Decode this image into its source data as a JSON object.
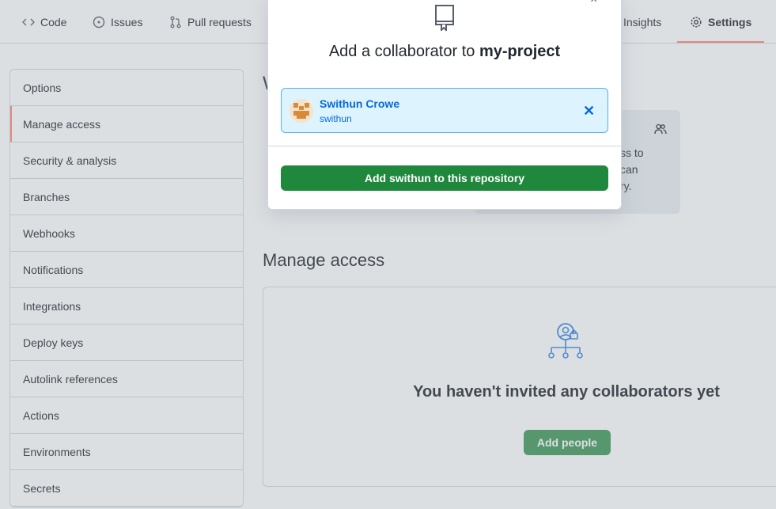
{
  "nav": {
    "tabs": [
      {
        "label": "Code",
        "icon": "code-icon"
      },
      {
        "label": "Issues",
        "icon": "issue-icon"
      },
      {
        "label": "Pull requests",
        "icon": "pull-request-icon"
      },
      {
        "label": "Insights",
        "icon": "graph-icon"
      },
      {
        "label": "Settings",
        "icon": "gear-icon",
        "selected": true
      }
    ]
  },
  "sidebar": {
    "items": [
      {
        "label": "Options"
      },
      {
        "label": "Manage access",
        "active": true
      },
      {
        "label": "Security & analysis"
      },
      {
        "label": "Branches"
      },
      {
        "label": "Webhooks"
      },
      {
        "label": "Notifications"
      },
      {
        "label": "Integrations"
      },
      {
        "label": "Deploy keys"
      },
      {
        "label": "Autolink references"
      },
      {
        "label": "Actions"
      },
      {
        "label": "Environments"
      },
      {
        "label": "Secrets"
      }
    ]
  },
  "main": {
    "partial_heading": "W",
    "info_lines": [
      "ss to",
      "can",
      "ry."
    ],
    "section_title": "Manage access",
    "blank_title": "You haven't invited any collaborators yet",
    "add_people_label": "Add people"
  },
  "modal": {
    "close_label": "×",
    "title_prefix": "Add a collaborator to",
    "repo_name": "my-project",
    "selected_user": {
      "name": "Swithun Crowe",
      "login": "swithun"
    },
    "remove_label": "✕",
    "confirm_label": "Add swithun to this repository"
  },
  "colors": {
    "accent_underline": "#fd8c73",
    "primary_button": "#1f883d",
    "link": "#0969da",
    "selected_bg": "#ddf4ff"
  }
}
